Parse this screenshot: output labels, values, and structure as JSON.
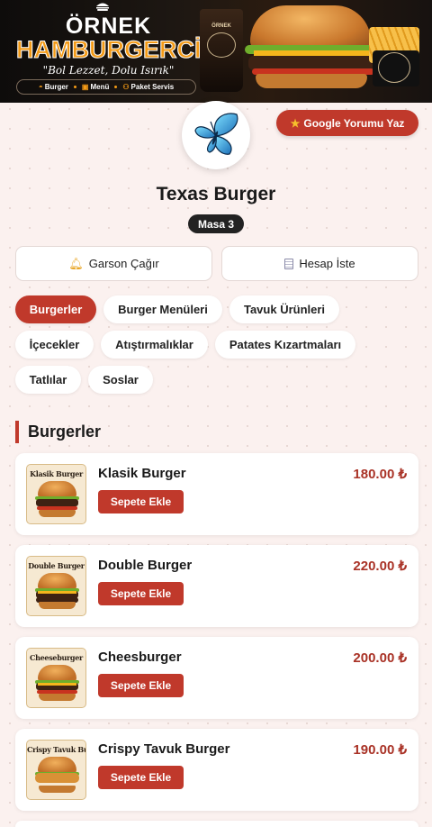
{
  "banner": {
    "brand_line1": "ÖRNEK",
    "brand_line2": "HAMBURGERCİ",
    "slogan": "\"Bol Lezzet, Dolu Isırık\"",
    "nav": [
      "Burger",
      "Menü",
      "Paket Servis"
    ],
    "cup_text": "ÖRNEK",
    "brand_color": "#f39a16"
  },
  "google_button": {
    "label": "Google Yorumu Yaz",
    "icon": "star-icon"
  },
  "restaurant": {
    "name": "Texas Burger",
    "table": "Masa 3",
    "avatar_icon": "butterfly-icon"
  },
  "actions": {
    "waiter": {
      "label": "Garson Çağır",
      "icon": "bell-icon"
    },
    "bill": {
      "label": "Hesap İste",
      "icon": "receipt-icon"
    }
  },
  "categories": [
    {
      "label": "Burgerler",
      "active": true
    },
    {
      "label": "Burger Menüleri",
      "active": false
    },
    {
      "label": "Tavuk Ürünleri",
      "active": false
    },
    {
      "label": "İçecekler",
      "active": false
    },
    {
      "label": "Atıştırmalıklar",
      "active": false
    },
    {
      "label": "Patates Kızartmaları",
      "active": false
    },
    {
      "label": "Tatlılar",
      "active": false
    },
    {
      "label": "Soslar",
      "active": false
    }
  ],
  "section": {
    "title": "Burgerler"
  },
  "products": [
    {
      "name": "Klasik Burger",
      "price": "180.00 ₺",
      "image_caption": "Klasik Burger",
      "add_label": "Sepete Ekle"
    },
    {
      "name": "Double Burger",
      "price": "220.00 ₺",
      "image_caption": "Double Burger",
      "add_label": "Sepete Ekle"
    },
    {
      "name": "Cheesburger",
      "price": "200.00 ₺",
      "image_caption": "Cheeseburger",
      "add_label": "Sepete Ekle"
    },
    {
      "name": "Crispy Tavuk Burger",
      "price": "190.00 ₺",
      "image_caption": "Crispy Tavuk Burger",
      "add_label": "Sepete Ekle"
    }
  ],
  "colors": {
    "accent": "#c0392b",
    "price": "#a93226",
    "background": "#fbf1ef"
  }
}
